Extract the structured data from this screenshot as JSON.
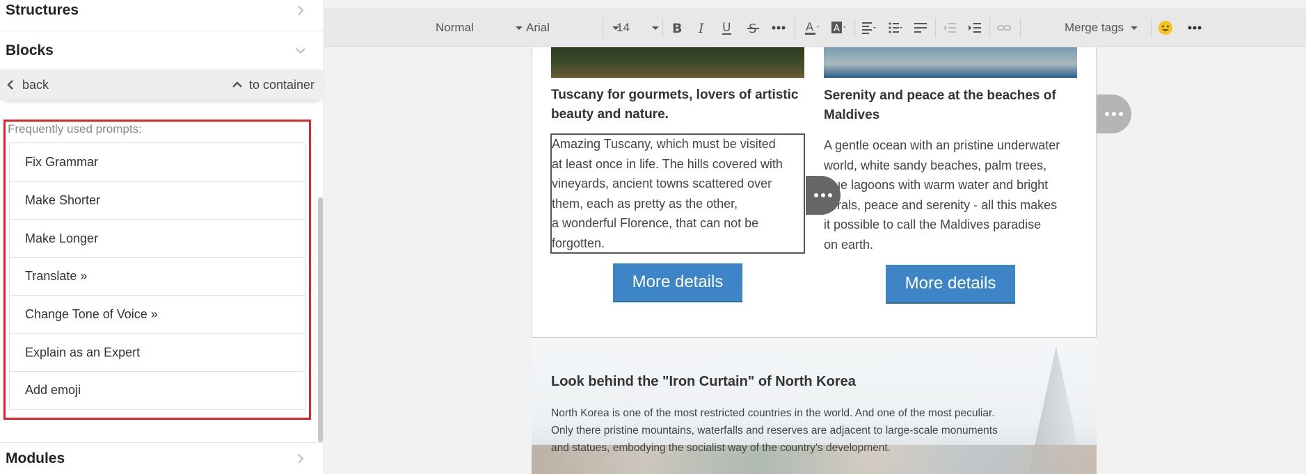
{
  "sidebar": {
    "structures_title": "Structures",
    "blocks_title": "Blocks",
    "modules_title": "Modules",
    "back_label": "back",
    "to_container_label": "to container",
    "prompts_header": "Frequently used prompts:",
    "prompts": [
      "Fix Grammar",
      "Make Shorter",
      "Make Longer",
      "Translate »",
      "Change Tone of Voice »",
      "Explain as an Expert",
      "Add emoji"
    ]
  },
  "toolbar": {
    "format": "Normal",
    "font": "Arial",
    "size": "14",
    "merge_tags": "Merge tags"
  },
  "content": {
    "col1_title": "Tuscany for gourmets, lovers of artistic beauty and nature.",
    "col1_text": [
      "Amazing Tuscany, which must be visited",
      "at least once in life. The hills covered with",
      "vineyards, ancient towns scattered over",
      "them, each as pretty as the other,",
      "a wonderful Florence, that can not be",
      "forgotten."
    ],
    "col2_title": "Serenity and peace at the beaches of Maldives",
    "col2_text": [
      "A gentle ocean with an pristine underwater",
      "world, white sandy beaches, palm trees,",
      "blue lagoons with warm water and bright",
      "corals, peace and serenity - all this makes",
      "it possible to call the Maldives paradise",
      "on earth."
    ],
    "button_label": "More details",
    "band_title": "Look behind the \"Iron Curtain\" of North Korea",
    "band_text": [
      "North Korea is one of the most restricted countries in the world. And one of the most peculiar.",
      "Only there pristine mountains, waterfalls and reserves are adjacent to large-scale monuments",
      "and statues, embodying the socialist way of the country's development."
    ]
  },
  "colors": {
    "highlight": "#e0242a",
    "button": "#3d85c6"
  }
}
